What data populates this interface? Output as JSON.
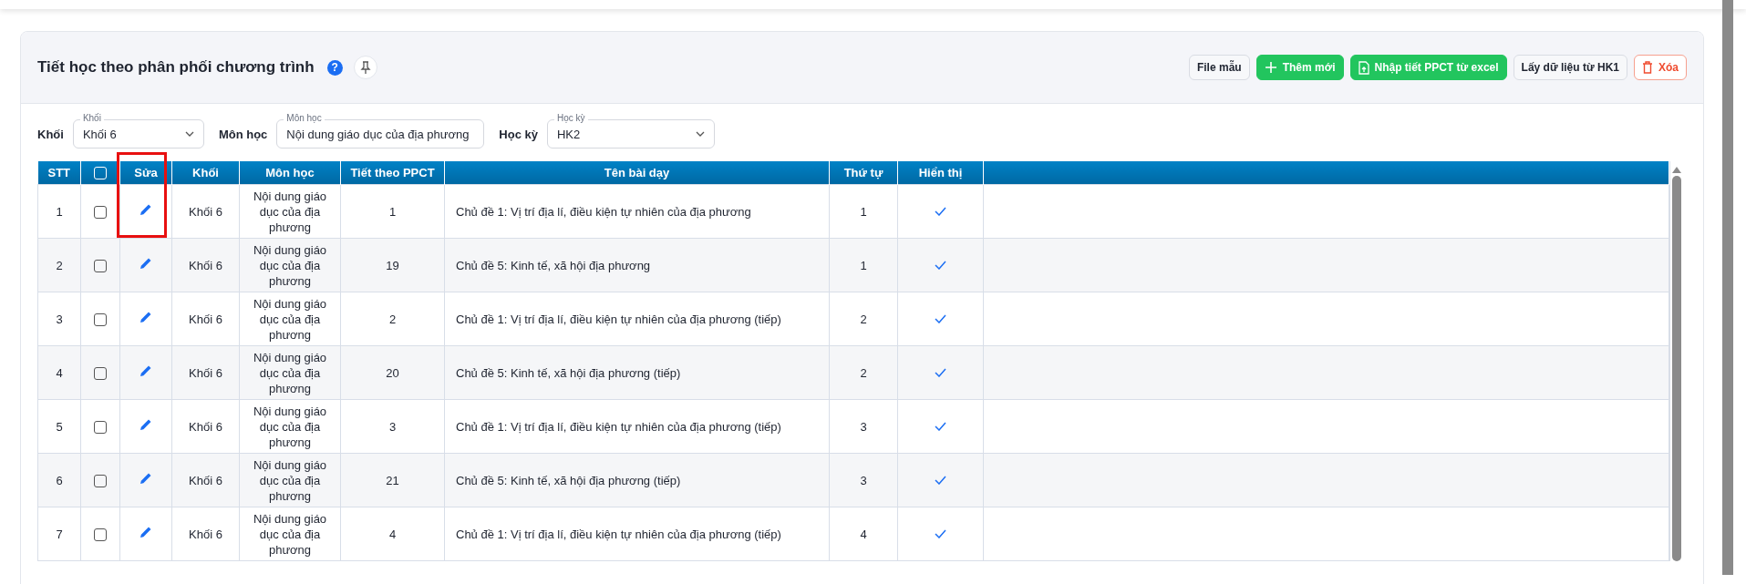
{
  "page": {
    "title": "Tiết học theo phân phối chương trình",
    "help_icon": "?"
  },
  "actions": [
    {
      "label": "File mẫu",
      "kind": "plain"
    },
    {
      "label": "Thêm mới",
      "kind": "add"
    },
    {
      "label": "Nhập tiết PPCT từ excel",
      "kind": "import"
    },
    {
      "label": "Lấy dữ liệu từ HK1",
      "kind": "plain"
    },
    {
      "label": "Xóa",
      "kind": "delete"
    }
  ],
  "filters": [
    {
      "label": "Khối",
      "floating_label": "Khối",
      "value": "Khối 6"
    },
    {
      "label": "Môn học",
      "floating_label": "Môn học",
      "value": "Nội dung giáo dục của địa phương"
    },
    {
      "label": "Học kỳ",
      "floating_label": "Học kỳ",
      "value": "HK2"
    }
  ],
  "table": {
    "select_all_checked": false,
    "columns": [
      {
        "label": "STT",
        "kind": "text",
        "highlighted": false
      },
      {
        "kind": "check",
        "highlighted": false
      },
      {
        "label": "Sửa",
        "kind": "edit",
        "highlighted": true
      },
      {
        "label": "Khối",
        "kind": "text",
        "highlighted": false
      },
      {
        "label": "Môn học",
        "kind": "text",
        "highlighted": false
      },
      {
        "label": "Tiết theo PPCT",
        "kind": "text",
        "highlighted": false
      },
      {
        "label": "Tên bài dạy",
        "kind": "left",
        "highlighted": false
      },
      {
        "label": "Thứ tự",
        "kind": "text",
        "highlighted": false
      },
      {
        "label": "Hiển thị",
        "kind": "shown",
        "highlighted": false
      }
    ],
    "rows": [
      {
        "stt": "1",
        "checked": false,
        "grade": "Khối 6",
        "subject": "Nội dung giáo dục của địa phương",
        "period": "1",
        "lesson": "Chủ đề 1: Vị trí địa lí, điều kiện tự nhiên của địa phương",
        "order": "1",
        "shown": true
      },
      {
        "stt": "2",
        "checked": false,
        "grade": "Khối 6",
        "subject": "Nội dung giáo dục của địa phương",
        "period": "19",
        "lesson": "Chủ đề 5: Kinh tế, xã hội địa phương",
        "order": "1",
        "shown": true
      },
      {
        "stt": "3",
        "checked": false,
        "grade": "Khối 6",
        "subject": "Nội dung giáo dục của địa phương",
        "period": "2",
        "lesson": "Chủ đề 1: Vị trí địa lí, điều kiện tự nhiên của địa phương (tiếp)",
        "order": "2",
        "shown": true
      },
      {
        "stt": "4",
        "checked": false,
        "grade": "Khối 6",
        "subject": "Nội dung giáo dục của địa phương",
        "period": "20",
        "lesson": "Chủ đề 5: Kinh tế, xã hội địa phương (tiếp)",
        "order": "2",
        "shown": true
      },
      {
        "stt": "5",
        "checked": false,
        "grade": "Khối 6",
        "subject": "Nội dung giáo dục của địa phương",
        "period": "3",
        "lesson": "Chủ đề 1: Vị trí địa lí, điều kiện tự nhiên của địa phương (tiếp)",
        "order": "3",
        "shown": true
      },
      {
        "stt": "6",
        "checked": false,
        "grade": "Khối 6",
        "subject": "Nội dung giáo dục của địa phương",
        "period": "21",
        "lesson": "Chủ đề 5: Kinh tế, xã hội địa phương (tiếp)",
        "order": "3",
        "shown": true
      },
      {
        "stt": "7",
        "checked": false,
        "grade": "Khối 6",
        "subject": "Nội dung giáo dục của địa phương",
        "period": "4",
        "lesson": "Chủ đề 1: Vị trí địa lí, điều kiện tự nhiên của địa phương (tiếp)",
        "order": "4",
        "shown": true
      }
    ]
  }
}
